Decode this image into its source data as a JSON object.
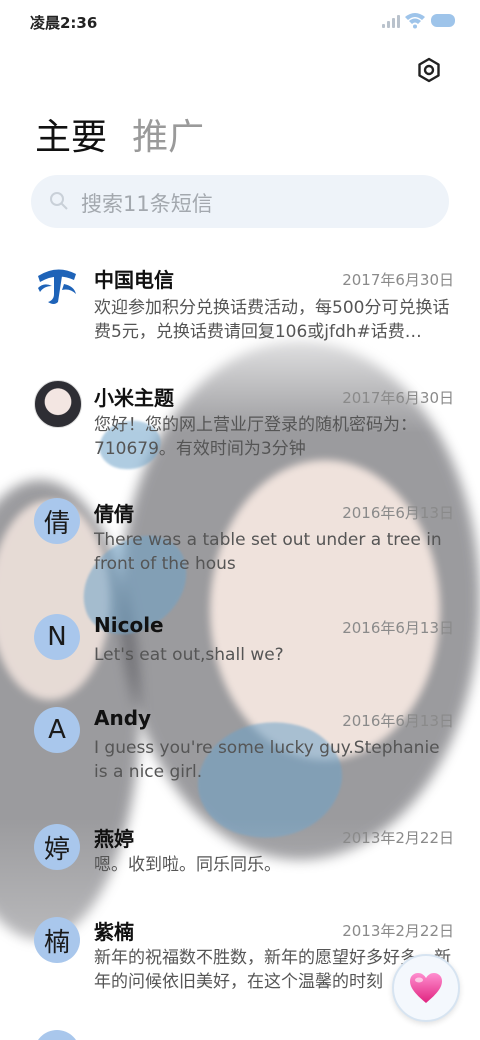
{
  "status_bar": {
    "time": "凌晨2:36"
  },
  "tabs": [
    {
      "label": "主要"
    },
    {
      "label": "推广"
    }
  ],
  "search": {
    "placeholder": "搜索11条短信"
  },
  "conversations": [
    {
      "name": "中国电信",
      "date": "2017年6月30日",
      "preview": "欢迎参加积分兑换话费活动，每500分可兑换话费5元，兑换话费请回复106或jfdh#话费…",
      "avatar": "china-telecom-logo"
    },
    {
      "name": "小米主题",
      "date": "2017年6月30日",
      "preview": "您好！您的网上营业厅登录的随机密码为：710679。有效时间为3分钟",
      "avatar": "photo"
    },
    {
      "name": "倩倩",
      "date": "2016年6月13日",
      "preview": "There was a table set out under a tree in front of the hous",
      "avatar_letter": "倩"
    },
    {
      "name": "Nicole",
      "date": "2016年6月13日",
      "preview": "Let's eat out,shall we?",
      "avatar_letter": "N"
    },
    {
      "name": "Andy",
      "date": "2016年6月13日",
      "preview": "I guess you're some lucky guy.Stephanie is a nice girl.",
      "avatar_letter": "A"
    },
    {
      "name": "燕婷",
      "date": "2013年2月22日",
      "preview": "嗯。收到啦。同乐同乐。",
      "avatar_letter": "婷"
    },
    {
      "name": "紫楠",
      "date": "2013年2月22日",
      "preview": "新年的祝福数不胜数，新年的愿望好多好多，新年的问候依旧美好，在这个温馨的时刻",
      "avatar_letter": "楠"
    }
  ],
  "colors": {
    "avatar_bg": "#a9c7ec",
    "accent": "#1e63b8",
    "search_bg": "#eef3f9"
  },
  "icons": {
    "settings": "settings-gear-icon",
    "fab": "heart-icon"
  }
}
